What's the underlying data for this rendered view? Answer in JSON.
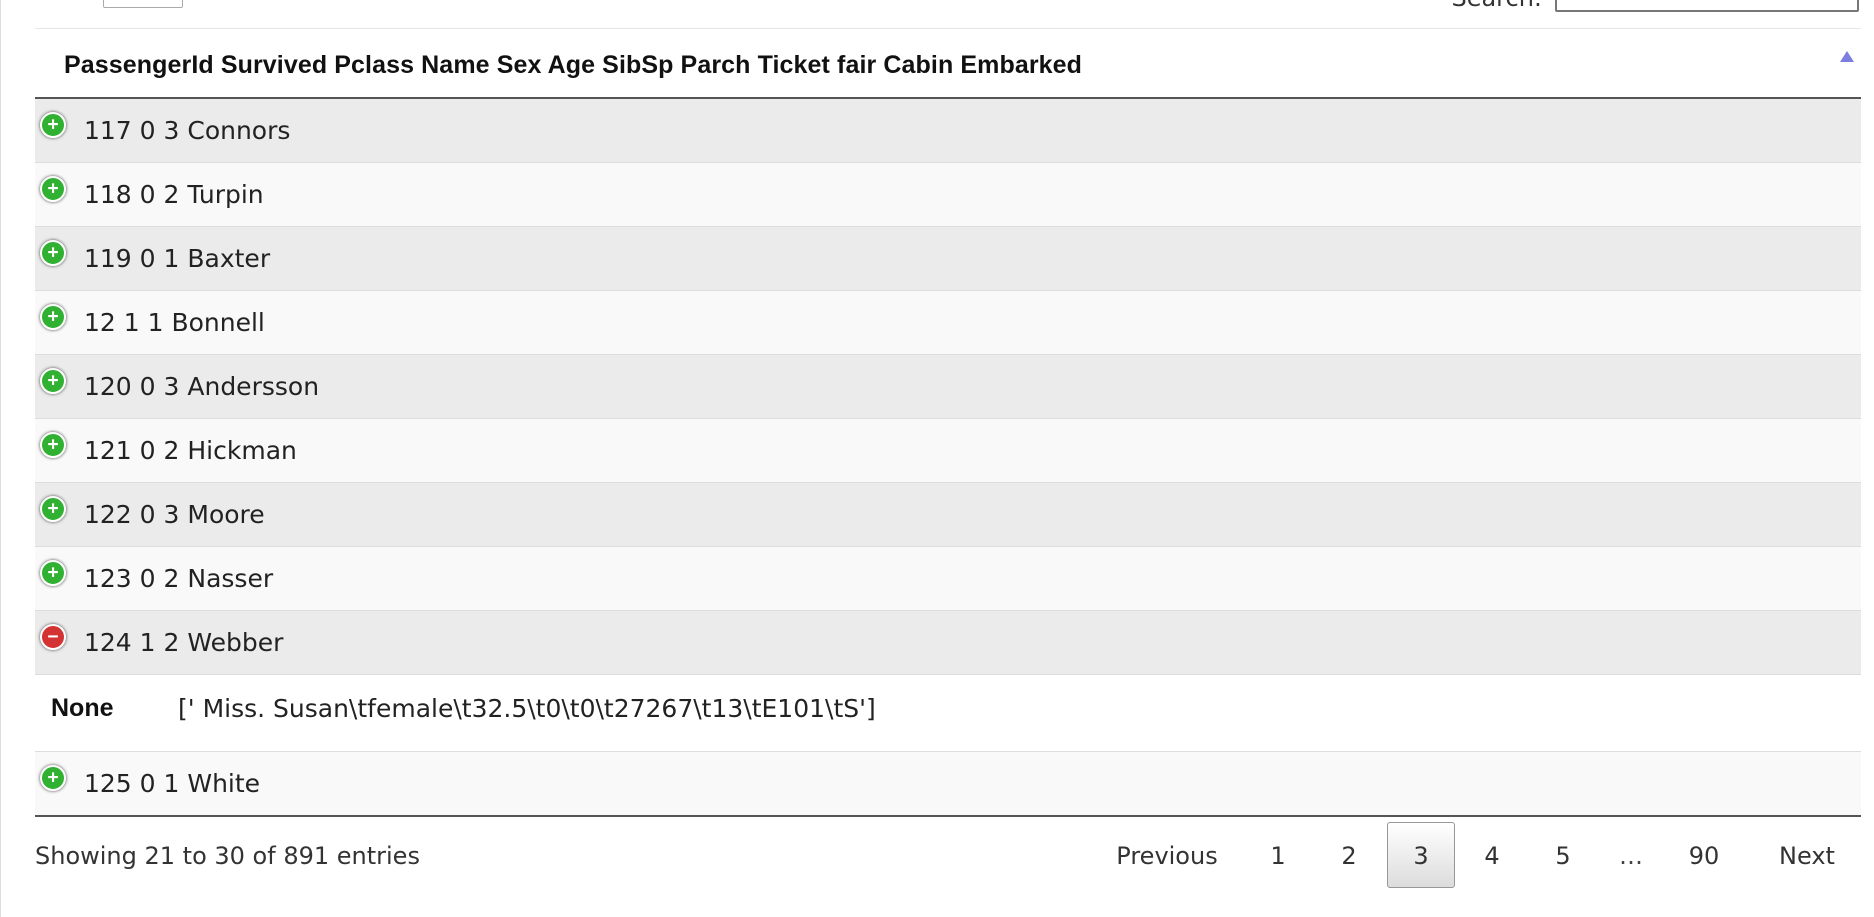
{
  "controls": {
    "search_label": "Search:"
  },
  "table": {
    "header": "PassengerId Survived Pclass Name Sex Age SibSp Parch Ticket fair Cabin Embarked",
    "rows": [
      {
        "text": "117 0 3 Connors",
        "expanded": false
      },
      {
        "text": "118 0 2 Turpin",
        "expanded": false
      },
      {
        "text": "119 0 1 Baxter",
        "expanded": false
      },
      {
        "text": "12 1 1 Bonnell",
        "expanded": false
      },
      {
        "text": "120 0 3 Andersson",
        "expanded": false
      },
      {
        "text": "121 0 2 Hickman",
        "expanded": false
      },
      {
        "text": "122 0 3 Moore",
        "expanded": false
      },
      {
        "text": "123 0 2 Nasser",
        "expanded": false
      },
      {
        "text": "124 1 2 Webber",
        "expanded": true
      },
      {
        "text": "125 0 1 White",
        "expanded": false
      }
    ],
    "child_row": {
      "key": "None",
      "value": "[' Miss. Susan\\tfemale\\t32.5\\t0\\t0\\t27267\\t13\\tE101\\tS']"
    }
  },
  "footer": {
    "info": "Showing 21 to 30 of 891 entries",
    "pagination": {
      "previous": "Previous",
      "pages": [
        "1",
        "2",
        "3",
        "4",
        "5"
      ],
      "current": "3",
      "ellipsis": "…",
      "last": "90",
      "next": "Next"
    }
  },
  "icons": {
    "expand": "plus-circle-icon",
    "collapse": "minus-circle-icon",
    "sort": "sort-asc-icon"
  },
  "colors": {
    "expand_green": "#31b131",
    "collapse_red": "#d33333",
    "sort_arrow": "#7a7fe0"
  }
}
